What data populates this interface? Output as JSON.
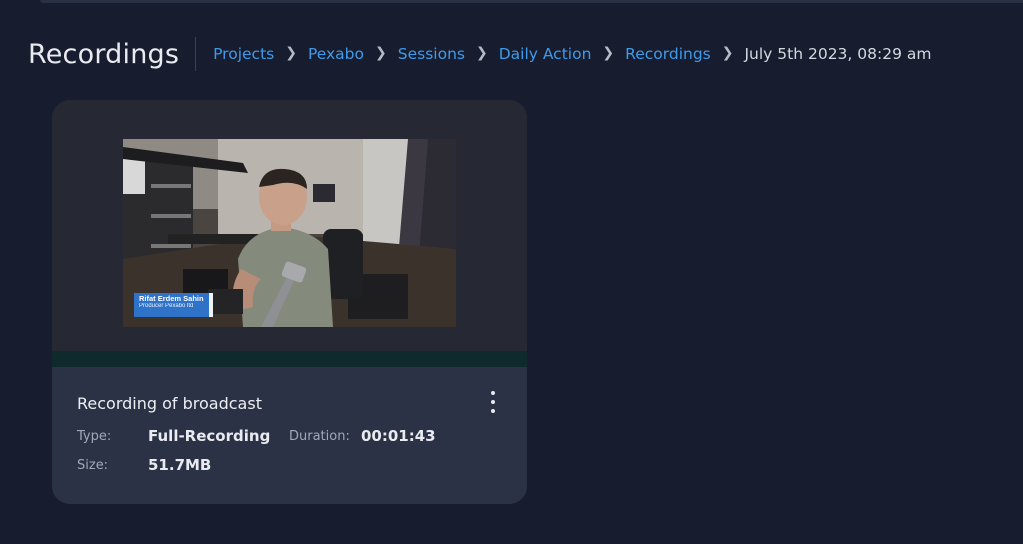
{
  "header": {
    "title": "Recordings",
    "breadcrumb": [
      {
        "label": "Projects"
      },
      {
        "label": "Pexabo"
      },
      {
        "label": "Sessions"
      },
      {
        "label": "Daily Action"
      },
      {
        "label": "Recordings"
      }
    ],
    "current": "July 5th 2023, 08:29 am"
  },
  "card": {
    "title": "Recording of broadcast",
    "type_label": "Type:",
    "type_value": "Full-Recording",
    "duration_label": "Duration:",
    "duration_value": "00:01:43",
    "size_label": "Size:",
    "size_value": "51.7MB",
    "nameplate": {
      "name": "Rifat Erdem Sahin",
      "role": "Producer Pexabo ltd"
    }
  },
  "colors": {
    "background": "#171c2e",
    "link": "#3f9bea",
    "card": "#2b3246"
  }
}
